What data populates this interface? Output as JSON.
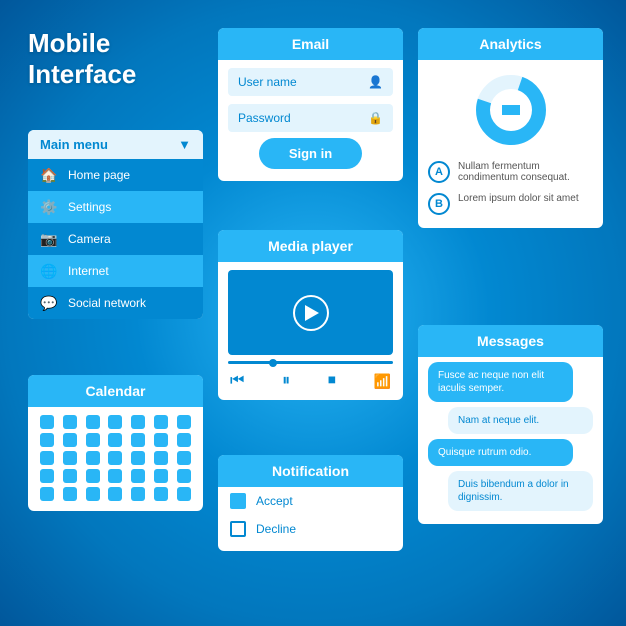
{
  "title": {
    "line1": "Mobile",
    "line2": "Interface"
  },
  "menu": {
    "label": "Main menu",
    "items": [
      {
        "label": "Home page",
        "icon": "🏠"
      },
      {
        "label": "Settings",
        "icon": "⚙️"
      },
      {
        "label": "Camera",
        "icon": "📷"
      },
      {
        "label": "Internet",
        "icon": "🌐"
      },
      {
        "label": "Social network",
        "icon": "💬"
      }
    ]
  },
  "calendar": {
    "label": "Calendar",
    "dots": 35
  },
  "email": {
    "label": "Email",
    "username_placeholder": "User name",
    "password_placeholder": "Password",
    "sign_in": "Sign in"
  },
  "media": {
    "label": "Media player"
  },
  "notification": {
    "label": "Notification",
    "items": [
      "Accept",
      "Decline"
    ]
  },
  "analytics": {
    "label": "Analytics",
    "item_a_text": "Nullam fermentum condimentum consequat.",
    "item_b_text": "Lorem ipsum dolor sit amet"
  },
  "messages": {
    "label": "Messages",
    "bubbles": [
      {
        "text": "Fusce ac neque non elit iaculis semper.",
        "side": "left"
      },
      {
        "text": "Nam at neque elit.",
        "side": "right"
      },
      {
        "text": "Quisque rutrum odio.",
        "side": "left"
      },
      {
        "text": "Duis bibendum a dolor in dignissim.",
        "side": "right"
      }
    ]
  }
}
